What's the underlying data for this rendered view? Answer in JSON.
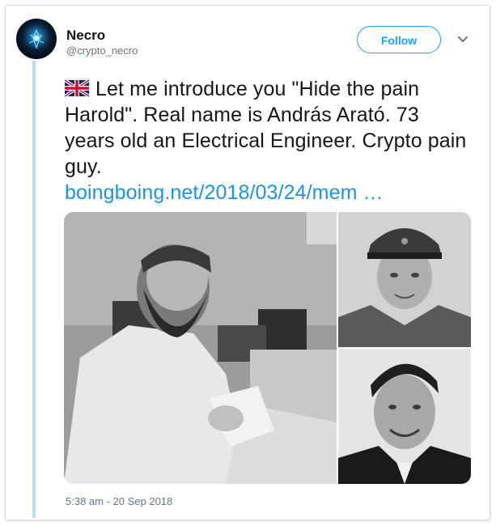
{
  "tweet": {
    "author_name": "Necro",
    "author_handle": "@crypto_necro",
    "follow_label": "Follow",
    "flag_icon": "uk-flag-icon",
    "text": "Let me introduce you \"Hide the pain Harold\". Real name is András Arató. 73 years old an Electrical Engineer. Crypto pain guy.",
    "link_text": "boingboing.net/2018/03/24/mem …",
    "timestamp": "5:38 am - 20 Sep 2018"
  },
  "media": {
    "photos": [
      {
        "name": "photo-man-reading-at-desk"
      },
      {
        "name": "photo-man-in-military-cap"
      },
      {
        "name": "photo-smiling-man-in-suit"
      }
    ]
  },
  "colors": {
    "accent": "#1da1f2",
    "link": "#1b95e0",
    "thread_line": "#b8dcf0",
    "secondary_text": "#657786"
  }
}
